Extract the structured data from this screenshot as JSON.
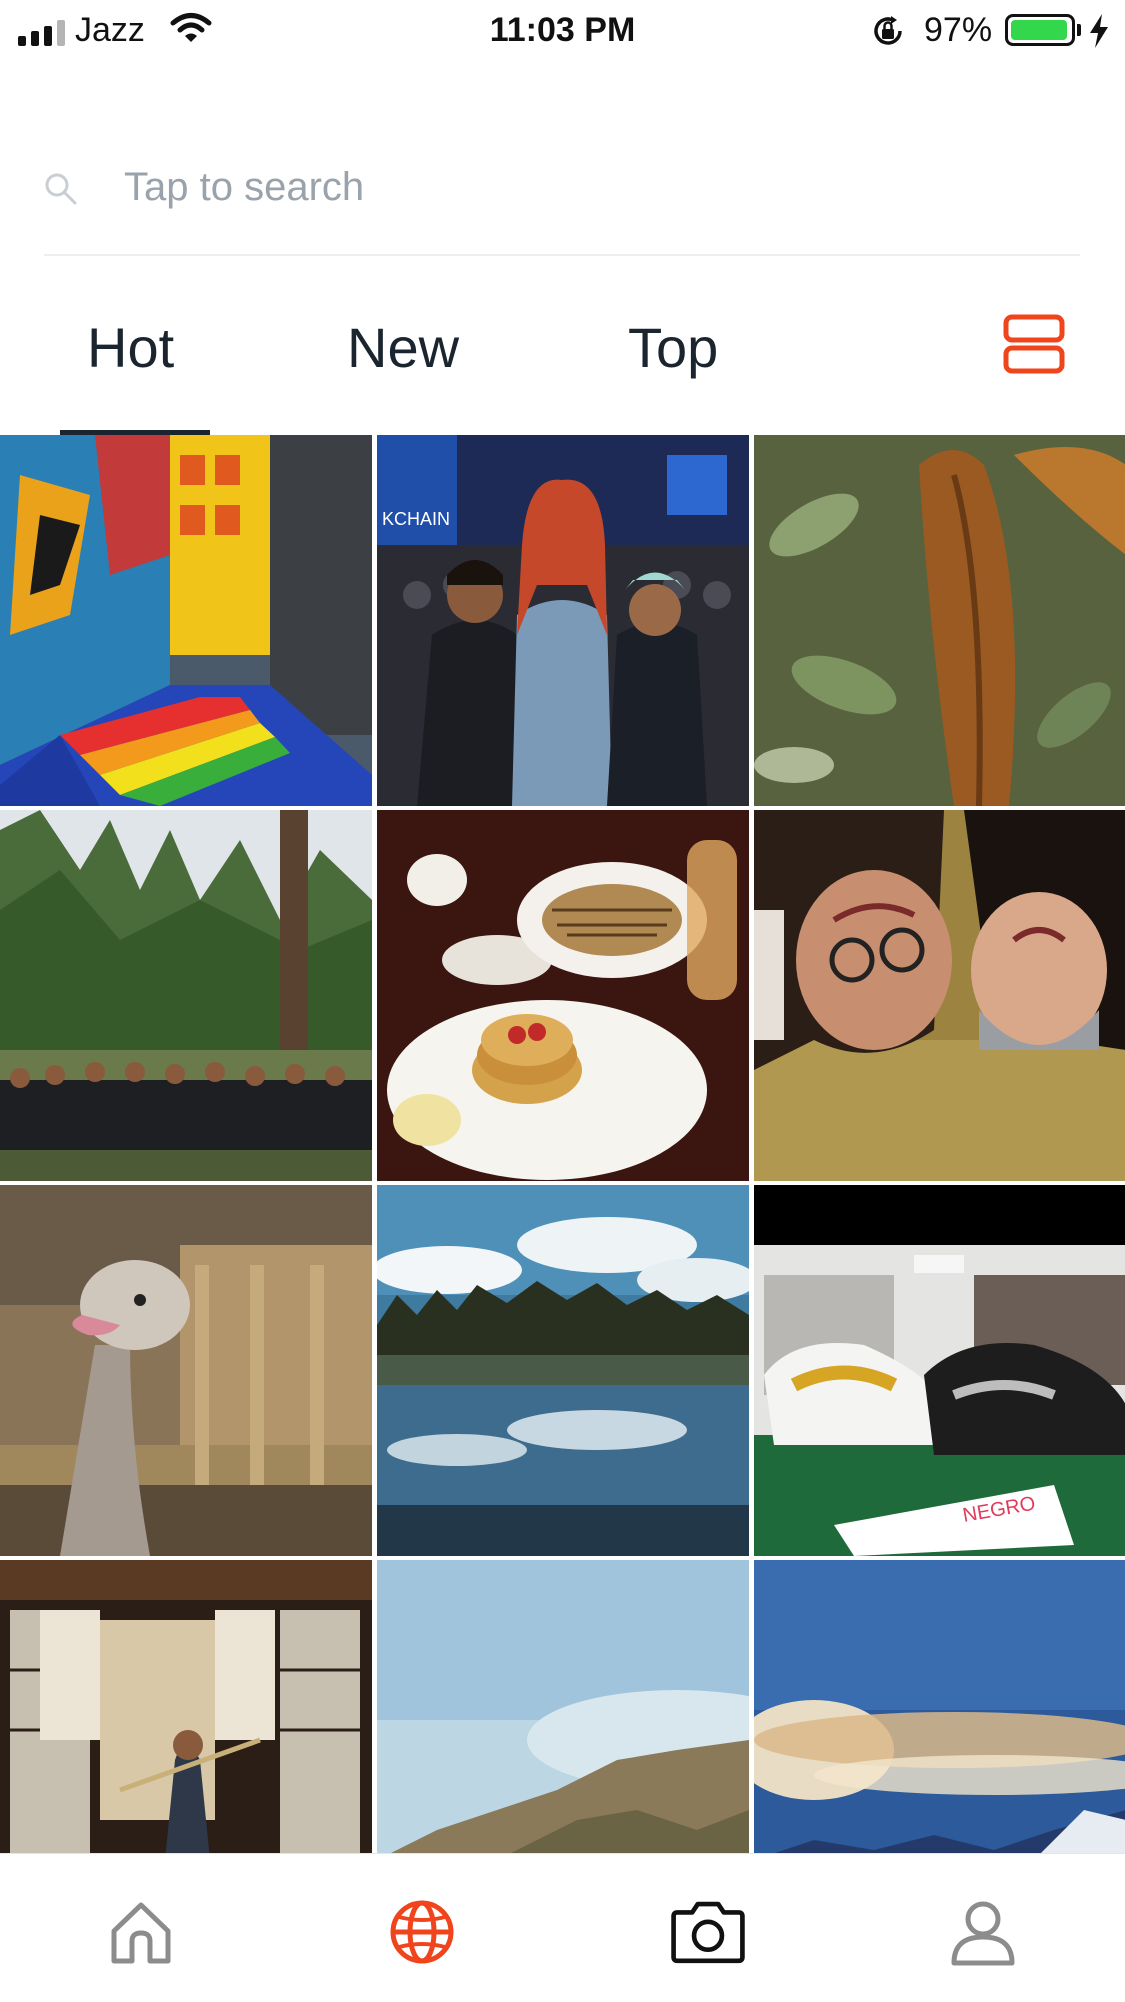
{
  "status_bar": {
    "carrier": "Jazz",
    "time": "11:03 PM",
    "battery_percent": "97%",
    "battery_level": 0.97,
    "signal_bars": 3,
    "icons": [
      "signal-icon",
      "wifi-icon",
      "rotation-lock-icon",
      "battery-icon",
      "charging-bolt-icon"
    ]
  },
  "search": {
    "placeholder": "Tap to search",
    "value": "",
    "icon": "search-icon"
  },
  "tabs": {
    "items": [
      {
        "label": "Hot",
        "active": true
      },
      {
        "label": "New",
        "active": false
      },
      {
        "label": "Top",
        "active": false
      }
    ],
    "layout_toggle_icon": "list-view-icon"
  },
  "grid": {
    "tiles": [
      {
        "subject": "rainbow-staircase-mural-photo"
      },
      {
        "subject": "blockchain-conference-group-photo"
      },
      {
        "subject": "dry-leaf-closeup-photo"
      },
      {
        "subject": "forest-group-photo"
      },
      {
        "subject": "pancakes-breakfast-photo"
      },
      {
        "subject": "upside-down-selfie-photo"
      },
      {
        "subject": "ostrich-photo"
      },
      {
        "subject": "lake-reflection-photo"
      },
      {
        "subject": "sneakers-store-photo"
      },
      {
        "subject": "martial-arts-dojo-photo"
      },
      {
        "subject": "foggy-coast-photo"
      },
      {
        "subject": "sunset-clouds-photo"
      }
    ]
  },
  "bottom_nav": {
    "items": [
      {
        "icon": "home-icon",
        "active": false
      },
      {
        "icon": "globe-icon",
        "active": true
      },
      {
        "icon": "camera-icon",
        "active": false
      },
      {
        "icon": "profile-icon",
        "active": false
      }
    ]
  },
  "colors": {
    "accent": "#f0441c",
    "text": "#1a2530",
    "placeholder": "#9aa3ab",
    "nav_inactive": "#8c8c8c",
    "battery": "#32d74b"
  }
}
